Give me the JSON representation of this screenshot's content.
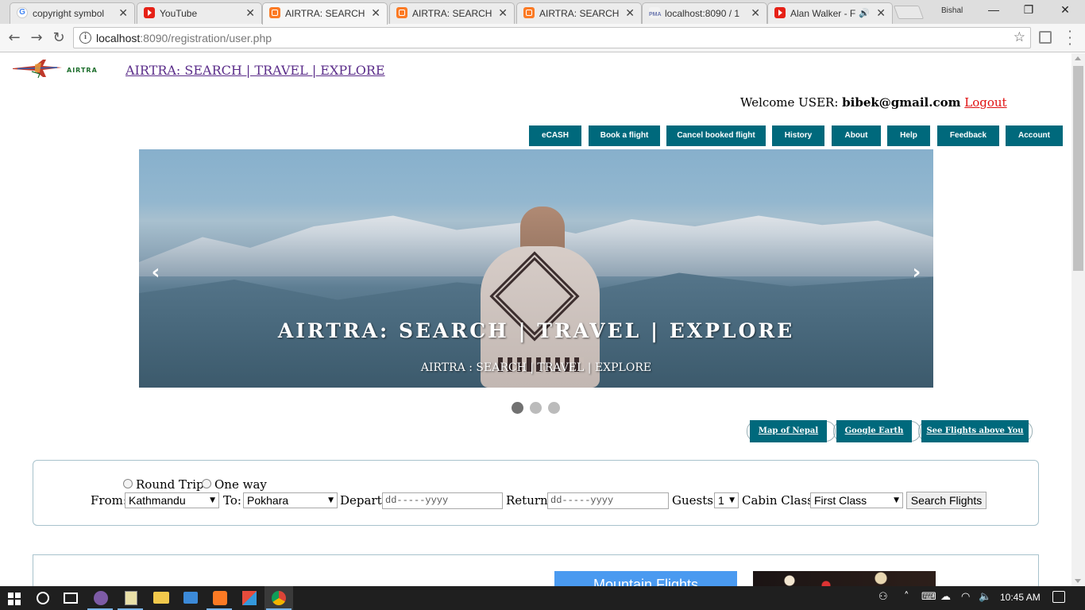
{
  "browser": {
    "tabs": [
      {
        "title": "copyright symbol",
        "favicon": "google-icon"
      },
      {
        "title": "YouTube",
        "favicon": "youtube-icon"
      },
      {
        "title": "AIRTRA: SEARCH |",
        "favicon": "xampp-icon",
        "active": true
      },
      {
        "title": "AIRTRA: SEARCH |",
        "favicon": "xampp-icon"
      },
      {
        "title": "AIRTRA: SEARCH |",
        "favicon": "xampp-icon"
      },
      {
        "title": "localhost:8090 / 1",
        "favicon": "phpmyadmin-icon"
      },
      {
        "title": "Alan Walker - F",
        "favicon": "youtube-icon"
      }
    ],
    "profile_name": "Bishal",
    "url_host": "localhost",
    "url_rest": ":8090/registration/user.php"
  },
  "header": {
    "brand_text": "AIRTRA",
    "site_link": "AIRTRA: SEARCH | TRAVEL | EXPLORE ",
    "welcome_prefix": "Welcome USER: ",
    "user_email": "bibek@gmail.com",
    "logout_label": "Logout"
  },
  "nav": {
    "items": [
      "eCASH",
      "Book a flight",
      "Cancel booked flight",
      "History",
      "About",
      "Help",
      "Feedback",
      "Account"
    ],
    "color": "#00697c"
  },
  "carousel": {
    "heading": "AIRTRA: SEARCH | TRAVEL | EXPLORE",
    "caption": "AIRTRA : SEARCH | TRAVEL | EXPLORE",
    "prev": "‹",
    "next": "›",
    "slide_count": 3,
    "active_slide": 1
  },
  "links": {
    "items": [
      "Map of Nepal",
      "Google Earth",
      "See Flights above You"
    ]
  },
  "search_form": {
    "round_trip_label": "Round Trip",
    "one_way_label": "One way",
    "from_label": "From:",
    "from_value": "Kathmandu",
    "to_label": "To:",
    "to_value": "Pokhara",
    "depart_label": "Depart:",
    "depart_placeholder": "dd-----yyyy",
    "return_label": "Return:",
    "return_placeholder": "dd-----yyyy",
    "guests_label": "Guests:",
    "guests_value": "1",
    "cabin_label": "Cabin Class:",
    "cabin_value": "First Class",
    "submit_label": "Search Flights"
  },
  "lower": {
    "mountain_flights": "Mountain Flights"
  },
  "taskbar": {
    "time": "10:45 AM"
  }
}
